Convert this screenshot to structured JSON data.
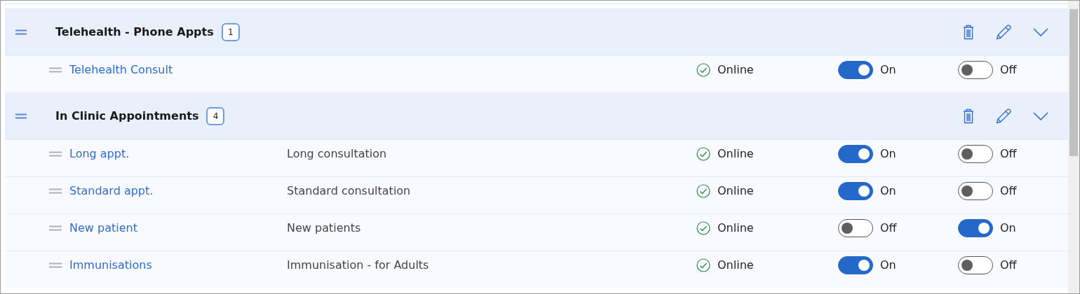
{
  "groups": [
    {
      "title": "Telehealth - Phone Appts",
      "count": "1",
      "expanded": true,
      "items": [
        {
          "name": "Telehealth Consult",
          "status": "Online",
          "toggle_1": {
            "on": true,
            "label": "On"
          },
          "toggle_2": {
            "on": false,
            "label": "Off"
          }
        }
      ]
    },
    {
      "title": "In Clinic Appointments",
      "count": "4",
      "expanded": true,
      "items": [
        {
          "name": "Long appt.",
          "description": "Long consultation",
          "status": "Online",
          "toggle_1": {
            "on": true,
            "label": "On"
          },
          "toggle_2": {
            "on": false,
            "label": "Off"
          }
        },
        {
          "name": "Standard appt.",
          "description": "Standard consultation",
          "status": "Online",
          "toggle_1": {
            "on": true,
            "label": "On"
          },
          "toggle_2": {
            "on": false,
            "label": "Off"
          }
        },
        {
          "name": "New patient",
          "description": "New patients",
          "status": "Online",
          "toggle_1": {
            "on": false,
            "label": "Off"
          },
          "toggle_2": {
            "on": true,
            "label": "On"
          }
        },
        {
          "name": "Immunisations",
          "description": "Immunisation - for Adults",
          "status": "Online",
          "toggle_1": {
            "on": true,
            "label": "On"
          },
          "toggle_2": {
            "on": false,
            "label": "Off"
          }
        }
      ]
    }
  ]
}
